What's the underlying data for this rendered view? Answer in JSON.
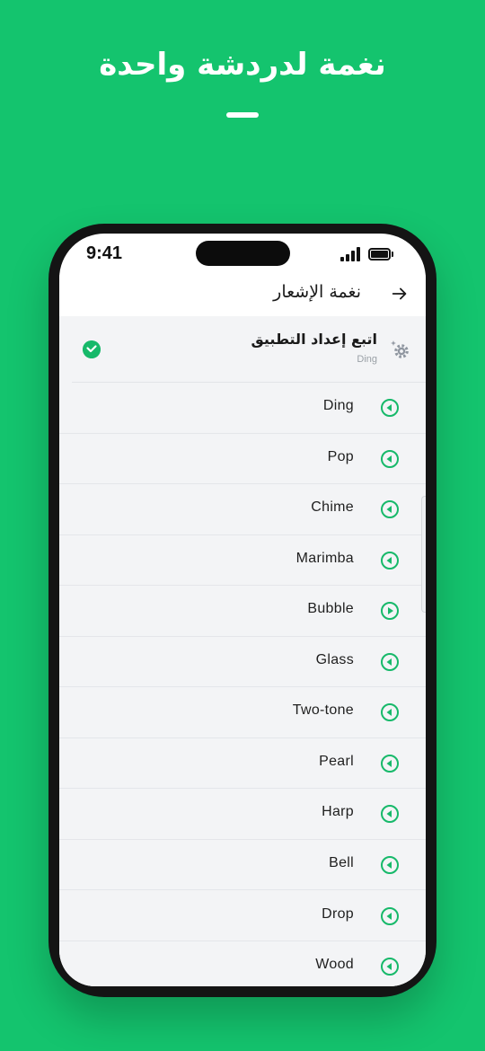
{
  "promo": {
    "title": "نغمة لدردشة واحدة"
  },
  "status_bar": {
    "time": "9:41"
  },
  "header": {
    "title": "نغمة الإشعار",
    "back_icon": "arrow-right-icon"
  },
  "follow_setting": {
    "title": "اتبع إعداد التطبيق",
    "current_tone": "Ding",
    "icon": "gear-sparkle-icon",
    "selected": true
  },
  "tones": [
    {
      "label": "Ding",
      "state": "play"
    },
    {
      "label": "Pop",
      "state": "play"
    },
    {
      "label": "Chime",
      "state": "play"
    },
    {
      "label": "Marimba",
      "state": "play"
    },
    {
      "label": "Bubble",
      "state": "playing"
    },
    {
      "label": "Glass",
      "state": "play"
    },
    {
      "label": "Two-tone",
      "state": "play"
    },
    {
      "label": "Pearl",
      "state": "play"
    },
    {
      "label": "Harp",
      "state": "play"
    },
    {
      "label": "Bell",
      "state": "play"
    },
    {
      "label": "Drop",
      "state": "play"
    },
    {
      "label": "Wood",
      "state": "play"
    }
  ],
  "colors": {
    "brand_green": "#14C46E",
    "accent_green": "#17B96A",
    "list_background": "#F3F4F6"
  }
}
